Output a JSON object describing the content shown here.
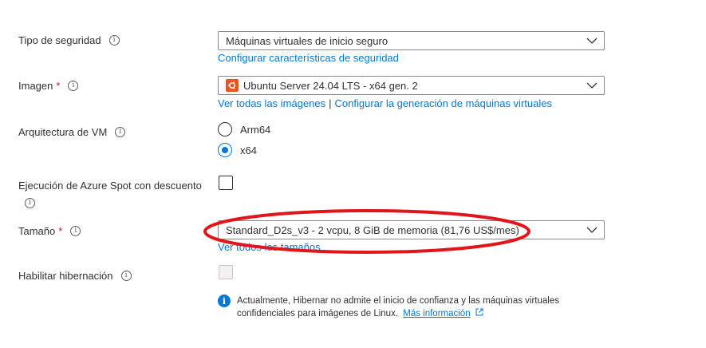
{
  "fields": {
    "security_type": {
      "label": "Tipo de seguridad",
      "value": "Máquinas virtuales de inicio seguro",
      "link": "Configurar características de seguridad"
    },
    "image": {
      "label": "Imagen",
      "required_mark": "*",
      "value": "Ubuntu Server 24.04 LTS - x64 gen. 2",
      "link_all": "Ver todas las imágenes",
      "separator": "|",
      "link_config": "Configurar la generación de máquinas virtuales"
    },
    "architecture": {
      "label": "Arquitectura de VM",
      "options": [
        "Arm64",
        "x64"
      ],
      "selected": "x64"
    },
    "spot": {
      "label": "Ejecución de Azure Spot con descuento",
      "checked": false
    },
    "size": {
      "label": "Tamaño",
      "required_mark": "*",
      "value": "Standard_D2s_v3 - 2 vcpu, 8 GiB de memoria (81,76 US$/mes)",
      "link": "Ver todos los tamaños"
    },
    "hibernation": {
      "label": "Habilitar hibernación",
      "checked": false,
      "disabled": true,
      "info_line1": "Actualmente, Hibernar no admite el inicio de confianza y las máquinas virtuales",
      "info_line2": "confidenciales para imágenes de Linux.",
      "info_link": "Más información"
    }
  },
  "icons": {
    "info": "i",
    "chevron": "chevron-down-icon",
    "external": "external-link-icon"
  },
  "colors": {
    "link": "#0078d4",
    "required": "#a4262c",
    "annotation": "#e0161b",
    "ubuntu": "#e95420"
  }
}
